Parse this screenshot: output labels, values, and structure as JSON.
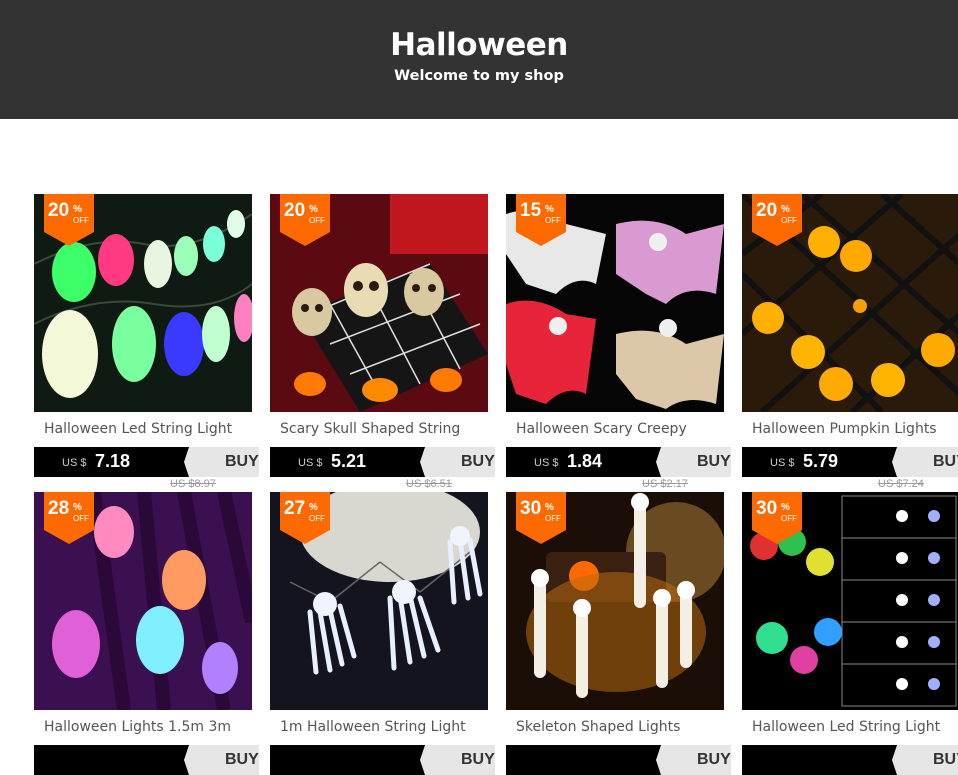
{
  "shop": {
    "title": "Halloween",
    "subtitle": "Welcome to my shop"
  },
  "labels": {
    "currency": "US $",
    "buy": "BUY",
    "off": "OFF",
    "percent": "%"
  },
  "products": [
    {
      "name": "Halloween Led String Light",
      "discount": "20",
      "price": "7.18",
      "old_price": "US $8.97",
      "image": "ghost-string-lights"
    },
    {
      "name": "Scary Skull Shaped String",
      "discount": "20",
      "price": "5.21",
      "old_price": "US $6.51",
      "image": "skull-string-lights"
    },
    {
      "name": "Halloween Scary Creepy",
      "discount": "15",
      "price": "1.84",
      "old_price": "US $2.17",
      "image": "hanging-ghosts"
    },
    {
      "name": "Halloween Pumpkin Lights",
      "discount": "20",
      "price": "5.79",
      "old_price": "US $7.24",
      "image": "pumpkin-lights"
    },
    {
      "name": "Halloween Lights 1.5m 3m",
      "discount": "28",
      "price": "",
      "old_price": "",
      "image": "colorful-ghost-lights"
    },
    {
      "name": "1m Halloween String Light",
      "discount": "27",
      "price": "",
      "old_price": "",
      "image": "skeleton-hand-lights"
    },
    {
      "name": "Skeleton Shaped Lights",
      "discount": "30",
      "price": "",
      "old_price": "",
      "image": "skeleton-lights"
    },
    {
      "name": "Halloween Led String Light",
      "discount": "30",
      "price": "",
      "old_price": "",
      "image": "eyeball-lights"
    }
  ],
  "colors": {
    "header_bg": "#333333",
    "badge": "#ff6a00",
    "price_bar": "#000000",
    "buy_bg": "#e6e6e6"
  }
}
